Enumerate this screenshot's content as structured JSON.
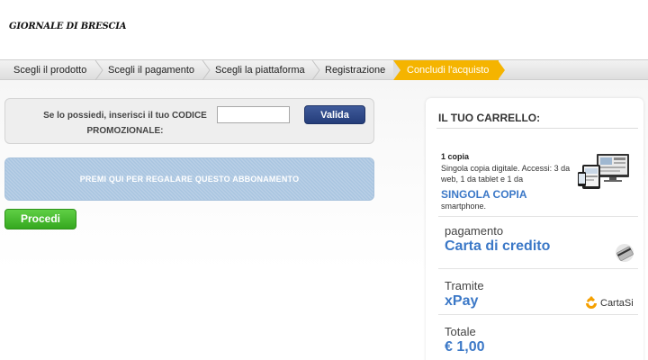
{
  "header": {
    "logo_text": "GIORNALE DI BRESCIA"
  },
  "steps": [
    {
      "label": "Scegli il prodotto",
      "active": false
    },
    {
      "label": "Scegli il pagamento",
      "active": false
    },
    {
      "label": "Scegli la piattaforma",
      "active": false
    },
    {
      "label": "Registrazione",
      "active": false
    },
    {
      "label": "Concludi l'acquisto",
      "active": true
    }
  ],
  "promo": {
    "text": "Se lo possiedi, inserisci il tuo CODICE PROMOZIONALE:",
    "input_value": "",
    "button_label": "Valida"
  },
  "gift_button": {
    "label": "PREMI QUI PER REGALARE QUESTO ABBONAMENTO"
  },
  "procedi_button": {
    "label": "Procedi"
  },
  "cart": {
    "title": "IL TUO CARRELLO:",
    "item": {
      "quantity": "1 copia",
      "description": "Singola copia digitale. Accessi: 3 da web, 1 da tablet e 1 da",
      "name": "SINGOLA COPIA",
      "extra": "smartphone."
    },
    "payment": {
      "label": "pagamento",
      "value": "Carta di credito",
      "icon": "credit-card-icon"
    },
    "via": {
      "label": "Tramite",
      "value": "xPay",
      "brand": "CartaSi"
    },
    "total": {
      "label": "Totale",
      "value": "€ 1,00"
    }
  },
  "colors": {
    "active_step": "#f5b400",
    "valida_button": "#2b4585",
    "gift_button": "#a9c5e0",
    "procedi_button": "#46b92e",
    "link_blue": "#3b78c7"
  }
}
